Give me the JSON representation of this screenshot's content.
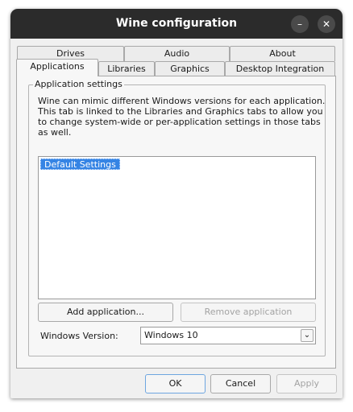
{
  "window": {
    "title": "Wine configuration"
  },
  "tabs_row1": [
    {
      "label": "Drives"
    },
    {
      "label": "Audio"
    },
    {
      "label": "About"
    }
  ],
  "tabs_row2": [
    {
      "label": "Applications",
      "selected": true
    },
    {
      "label": "Libraries"
    },
    {
      "label": "Graphics"
    },
    {
      "label": "Desktop Integration"
    }
  ],
  "app_settings": {
    "group_title": "Application settings",
    "description_lines": [
      "Wine can mimic different Windows versions for each application.",
      "This tab is linked to the Libraries and Graphics tabs to allow you",
      "to change system-wide or per-application settings in those tabs",
      "as well."
    ],
    "app_list": [
      {
        "label": "Default Settings",
        "selected": true
      }
    ],
    "add_button": "Add application...",
    "remove_button": "Remove application",
    "windows_version_label": "Windows Version:",
    "windows_version_value": "Windows 10"
  },
  "dialog_buttons": {
    "ok": "OK",
    "cancel": "Cancel",
    "apply": "Apply"
  },
  "colors": {
    "titlebar": "#2b2b2b",
    "selection": "#3584e4"
  },
  "icons": {
    "minimize": "minimize-icon",
    "close": "close-icon",
    "dropdown": "chevron-down-icon"
  }
}
